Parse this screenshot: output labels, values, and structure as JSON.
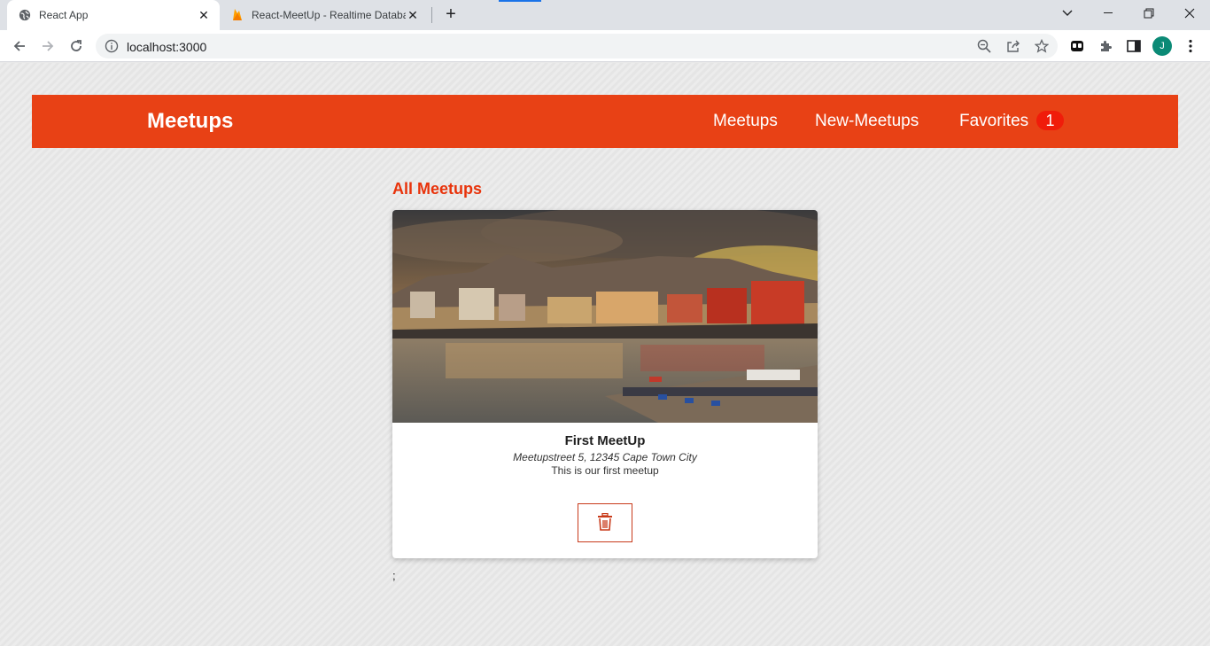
{
  "browser": {
    "tabs": [
      {
        "title": "React App",
        "icon": "globe-icon"
      },
      {
        "title": "React-MeetUp - Realtime Databa",
        "icon": "firebase-icon"
      }
    ],
    "url": "localhost:3000",
    "profile_initial": "J",
    "profile_color": "#0b8a76"
  },
  "app": {
    "brand": "Meetups",
    "accent": "#e84115",
    "nav": [
      {
        "label": "Meetups"
      },
      {
        "label": "New-Meetups"
      },
      {
        "label": "Favorites"
      }
    ],
    "favorites_count": "1"
  },
  "main": {
    "heading": "All Meetups",
    "meetups": [
      {
        "title": "First MeetUp",
        "address": "Meetupstreet 5, 12345 Cape Town City",
        "description": "This is our first meetup",
        "image": "cape-town-waterfront-photo",
        "action_icon": "trash-icon"
      }
    ],
    "stray_text": ";"
  }
}
